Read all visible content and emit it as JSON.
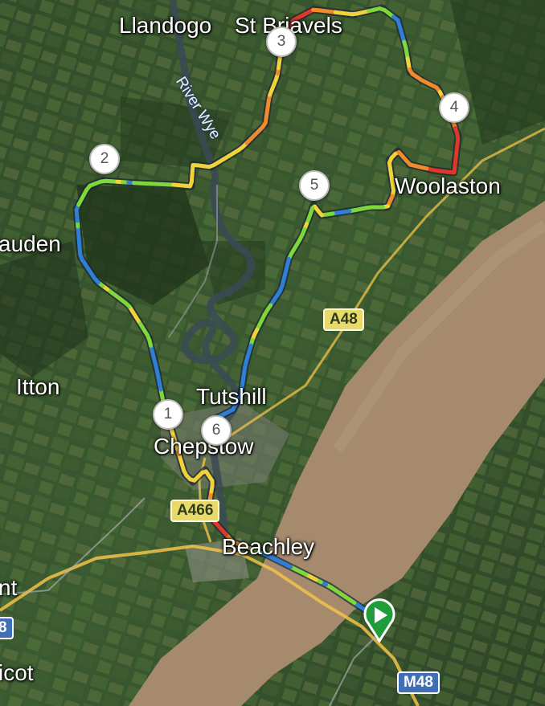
{
  "places": {
    "llandogo": "Llandogo",
    "st_briavels": "St Briavels",
    "woolaston": "Woolaston",
    "auden": "auden",
    "itton": "Itton",
    "tutshill": "Tutshill",
    "chepstow": "Chepstow",
    "beachley": "Beachley",
    "nt": "nt",
    "icot": "icot"
  },
  "river_label": "River Wye",
  "roads": {
    "a48": "A48",
    "a466": "A466",
    "m48": "M48",
    "m48_partial": "8"
  },
  "waypoints": [
    "1",
    "2",
    "3",
    "4",
    "5",
    "6"
  ],
  "start_icon": "start-play-icon",
  "colors": {
    "route_fast": "#2f7fd8",
    "route_mid": "#7fd83a",
    "route_slow": "#e0372b",
    "road_major": "#f2c24a",
    "estuary": "#a58a6e"
  }
}
